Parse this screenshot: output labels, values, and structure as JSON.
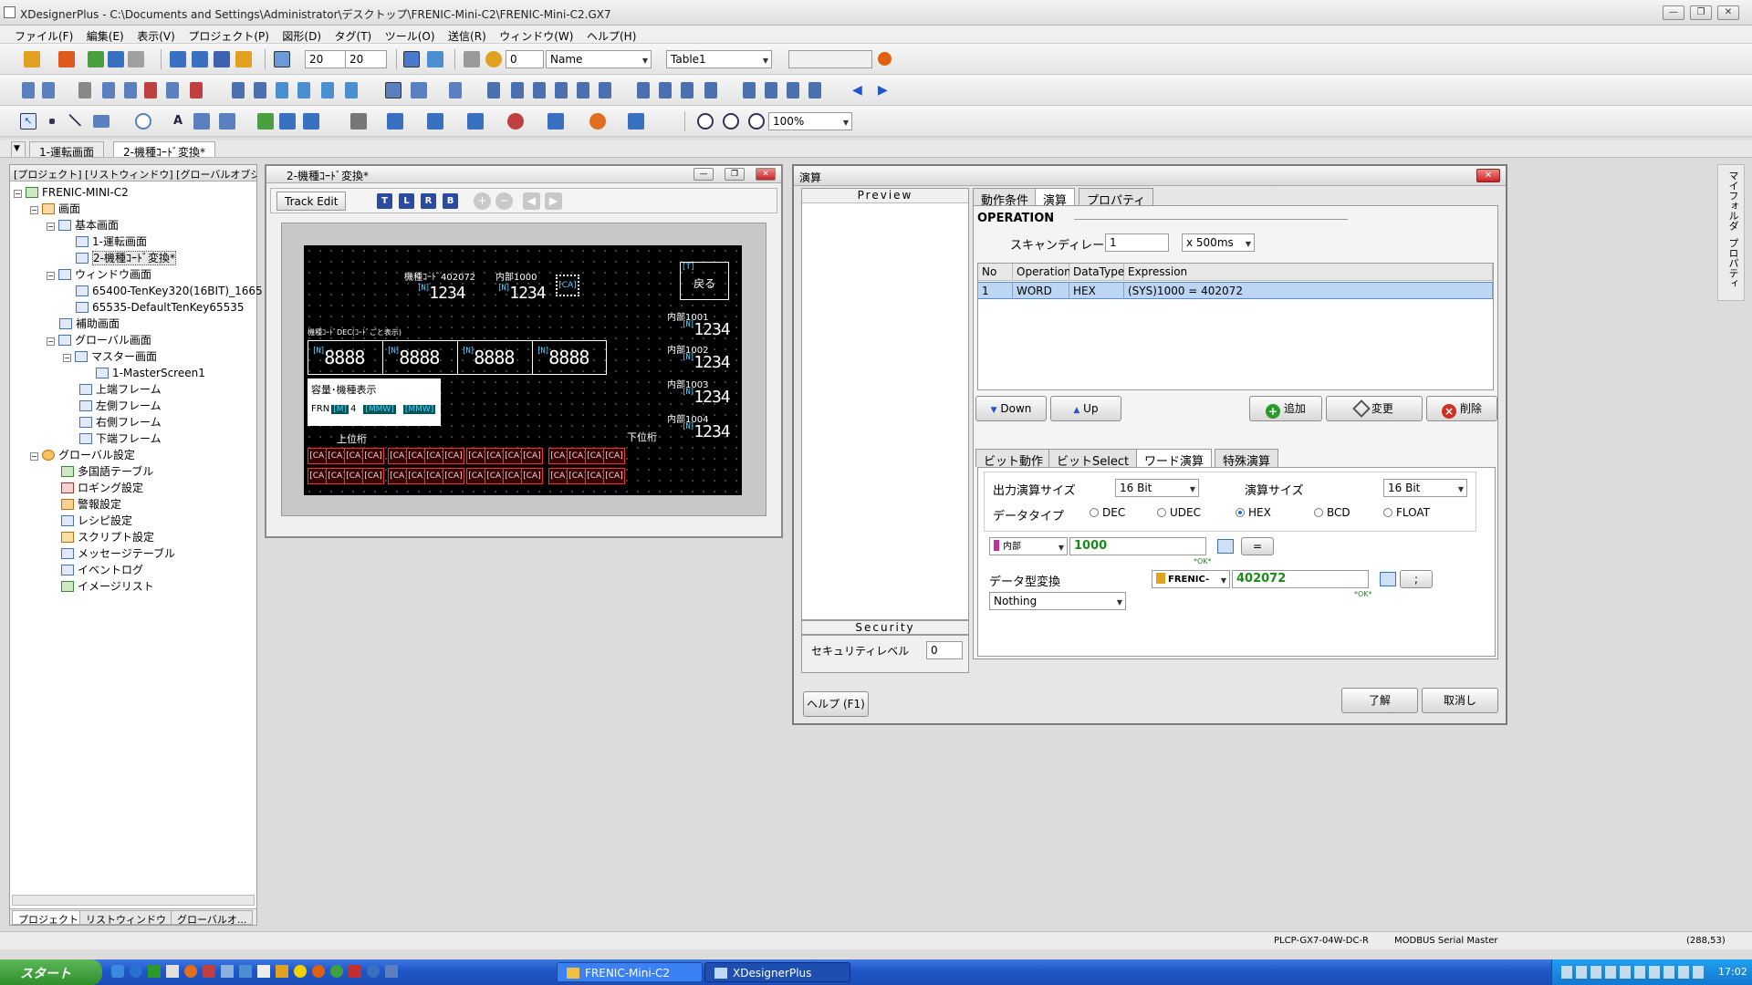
{
  "window": {
    "title": "XDesignerPlus - C:\\Documents and Settings\\Administrator\\デスクトップ\\FRENIC-Mini-C2\\FRENIC-Mini-C2.GX7"
  },
  "menu": [
    "ファイル(F)",
    "編集(E)",
    "表示(V)",
    "プロジェクト(P)",
    "図形(D)",
    "タグ(T)",
    "ツール(O)",
    "送信(R)",
    "ウィンドウ(W)",
    "ヘルプ(H)"
  ],
  "toolbar": {
    "grid_x": "20",
    "grid_y": "20",
    "value_zero": "0",
    "name_select": "Name",
    "table_select": "Table1",
    "zoom": "100%"
  },
  "doc_tabs": [
    "1-運転画面",
    "2-機種ｺｰﾄﾞ変換*"
  ],
  "left_panel": {
    "header": "[プロジェクト] [リストウィンドウ] [グローバルオブジ...",
    "tree": {
      "root": "FRENIC-MINI-C2",
      "screens": "画面",
      "basic": "基本画面",
      "s1": "1-運転画面",
      "s2": "2-機種ｺｰﾄﾞ変換*",
      "windows": "ウィンドウ画面",
      "w1": "65400-TenKey320(16BIT)_1665",
      "w2": "65535-DefaultTenKey65535",
      "aux": "補助画面",
      "global": "グローバル画面",
      "master": "マスター画面",
      "m1": "1-MasterScreen1",
      "top": "上端フレーム",
      "left": "左側フレーム",
      "right": "右側フレーム",
      "bottom": "下端フレーム",
      "gset": "グローバル設定",
      "g1": "多国語テーブル",
      "g2": "ロギング設定",
      "g3": "警報設定",
      "g4": "レシピ設定",
      "g5": "スクリプト設定",
      "g6": "メッセージテーブル",
      "g7": "イベントログ",
      "g8": "イメージリスト"
    },
    "tabs": [
      "プロジェクト",
      "リストウィンドウ",
      "グローバルオ..."
    ]
  },
  "screen_window": {
    "title": "2-機種ｺｰﾄﾞ変換*",
    "track_edit": "Track Edit",
    "align_buttons": [
      "T",
      "L",
      "R",
      "B"
    ],
    "hmi": {
      "model_code_label": "機種ｺｰﾄﾞ402072",
      "internal1000": "内部1000",
      "back_button": "戻る",
      "back_tag": "[T]",
      "dec_label": "機種ｺｰﾄﾞDEC(ｺｰﾄﾞごと表示)",
      "capacity_label": "容量･機種表示",
      "frn_prefix": "FRN",
      "upper": "上位桁",
      "lower": "下位桁",
      "i1001": "内部1001",
      "i1002": "内部1002",
      "i1003": "内部1003",
      "i1004": "内部1004",
      "num": "1234",
      "num8": "8888",
      "ntag": "[N]",
      "ca": "[CA]"
    }
  },
  "dialog": {
    "title": "演算",
    "preview": "Preview",
    "security": "Security",
    "security_level_label": "セキュリティレベル",
    "security_level": "0",
    "help_button": "ヘルプ (F1)",
    "ok_button": "了解",
    "cancel_button": "取消し",
    "tabs": [
      "動作条件",
      "演算",
      "プロパティ"
    ],
    "operation_header": "OPERATION",
    "scan_delay_label": "スキャンディレー",
    "scan_delay": "1",
    "scan_unit": "x 500ms",
    "table": {
      "columns": [
        "No",
        "Operation",
        "DataType",
        "Expression"
      ],
      "rows": [
        [
          "1",
          "WORD",
          "HEX",
          "(SYS)1000 = 402072"
        ]
      ]
    },
    "down_button": "Down",
    "up_button": "Up",
    "add_button": "追加",
    "change_button": "変更",
    "delete_button": "削除",
    "calc_tabs": [
      "ビット動作",
      "ビットSelect",
      "ワード演算",
      "特殊演算"
    ],
    "output_size_label": "出力演算サイズ",
    "output_size": "16 Bit",
    "calc_size_label": "演算サイズ",
    "calc_size": "16 Bit",
    "data_type_label": "データタイプ",
    "data_types": [
      "DEC",
      "UDEC",
      "HEX",
      "BCD",
      "FLOAT"
    ],
    "selected_type": "HEX",
    "device": "内部",
    "address": "1000",
    "ok_hint": "*OK*",
    "eq_button": "=",
    "convert_label": "データ型変換",
    "convert_value": "Nothing",
    "device2": "FRENIC-",
    "value2": "402072",
    "semicolon_button": ";"
  },
  "side_strip": [
    "マイフォルダ",
    "プロパティ"
  ],
  "status": {
    "model": "PLCP-GX7-04W-DC-R",
    "protocol": "MODBUS Serial Master",
    "coords": "(288,53)"
  },
  "taskbar": {
    "start": "スタート",
    "tasks": [
      "FRENIC-Mini-C2",
      "XDesignerPlus"
    ],
    "clock": "17:02"
  },
  "colors": {
    "selection": "#bcd6f3",
    "accent": "#2a4ca0",
    "green_value": "#1a8a1a"
  }
}
